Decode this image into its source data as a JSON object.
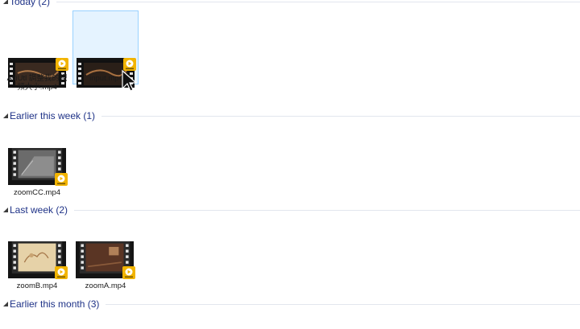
{
  "groups": [
    {
      "label": "Today (2)"
    },
    {
      "label": "Earlier this week (1)"
    },
    {
      "label": "Last week (2)"
    },
    {
      "label": "Earlier this month (3)"
    }
  ],
  "files": {
    "aviutl": {
      "name": "AviUtl 調整我的視頻大小.mp4",
      "thumb_color": "#3a2a20"
    },
    "input": {
      "name": "input.mp4",
      "thumb_color": "#2a1f18"
    },
    "zoomcc": {
      "name": "zoomCC.mp4",
      "thumb_color": "#6b6b6b"
    },
    "zoomb": {
      "name": "zoomB.mp4",
      "thumb_color": "#e6d2a8"
    },
    "zooma": {
      "name": "zoomA.mp4",
      "thumb_color": "#5a3524"
    }
  },
  "badge": {
    "icon": "player-badge-icon",
    "color": "#f2b400",
    "text": "Player"
  },
  "colors": {
    "header_text": "#1e3287",
    "selection_bg": "#e5f3ff",
    "selection_border": "#99d1ff"
  }
}
